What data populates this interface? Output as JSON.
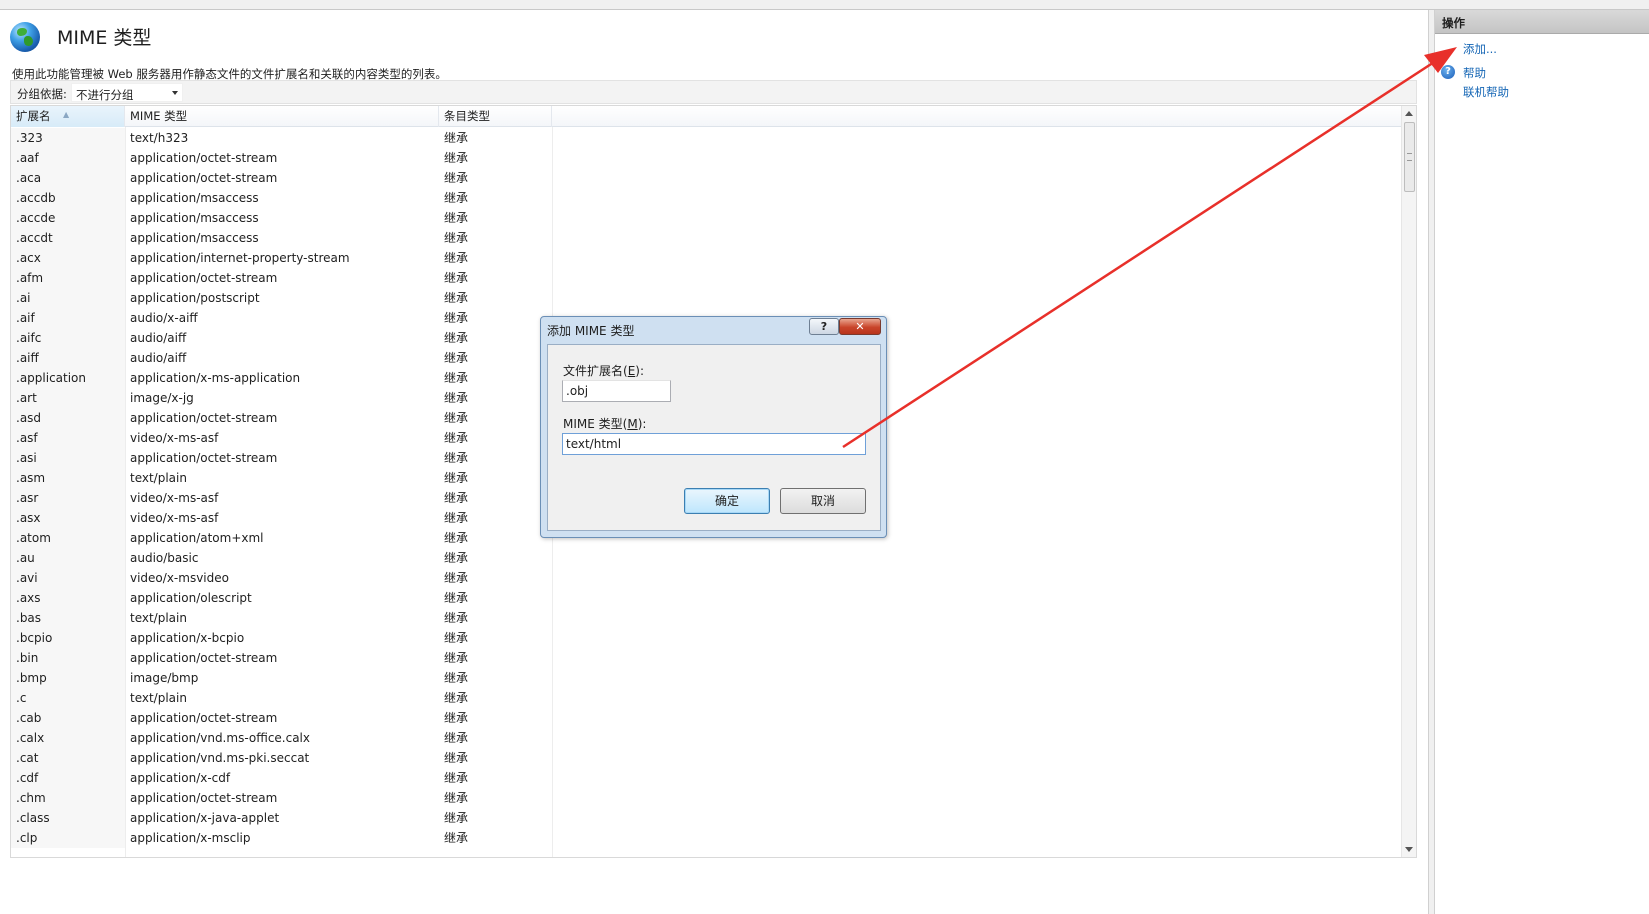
{
  "page": {
    "title": "MIME 类型",
    "description": "使用此功能管理被 Web 服务器用作静态文件的文件扩展名和关联的内容类型的列表。",
    "group_label": "分组依据:",
    "group_value": "不进行分组"
  },
  "table": {
    "columns": [
      "扩展名",
      "MIME 类型",
      "条目类型"
    ],
    "rows": [
      [
        ".323",
        "text/h323",
        "继承"
      ],
      [
        ".aaf",
        "application/octet-stream",
        "继承"
      ],
      [
        ".aca",
        "application/octet-stream",
        "继承"
      ],
      [
        ".accdb",
        "application/msaccess",
        "继承"
      ],
      [
        ".accde",
        "application/msaccess",
        "继承"
      ],
      [
        ".accdt",
        "application/msaccess",
        "继承"
      ],
      [
        ".acx",
        "application/internet-property-stream",
        "继承"
      ],
      [
        ".afm",
        "application/octet-stream",
        "继承"
      ],
      [
        ".ai",
        "application/postscript",
        "继承"
      ],
      [
        ".aif",
        "audio/x-aiff",
        "继承"
      ],
      [
        ".aifc",
        "audio/aiff",
        "继承"
      ],
      [
        ".aiff",
        "audio/aiff",
        "继承"
      ],
      [
        ".application",
        "application/x-ms-application",
        "继承"
      ],
      [
        ".art",
        "image/x-jg",
        "继承"
      ],
      [
        ".asd",
        "application/octet-stream",
        "继承"
      ],
      [
        ".asf",
        "video/x-ms-asf",
        "继承"
      ],
      [
        ".asi",
        "application/octet-stream",
        "继承"
      ],
      [
        ".asm",
        "text/plain",
        "继承"
      ],
      [
        ".asr",
        "video/x-ms-asf",
        "继承"
      ],
      [
        ".asx",
        "video/x-ms-asf",
        "继承"
      ],
      [
        ".atom",
        "application/atom+xml",
        "继承"
      ],
      [
        ".au",
        "audio/basic",
        "继承"
      ],
      [
        ".avi",
        "video/x-msvideo",
        "继承"
      ],
      [
        ".axs",
        "application/olescript",
        "继承"
      ],
      [
        ".bas",
        "text/plain",
        "继承"
      ],
      [
        ".bcpio",
        "application/x-bcpio",
        "继承"
      ],
      [
        ".bin",
        "application/octet-stream",
        "继承"
      ],
      [
        ".bmp",
        "image/bmp",
        "继承"
      ],
      [
        ".c",
        "text/plain",
        "继承"
      ],
      [
        ".cab",
        "application/octet-stream",
        "继承"
      ],
      [
        ".calx",
        "application/vnd.ms-office.calx",
        "继承"
      ],
      [
        ".cat",
        "application/vnd.ms-pki.seccat",
        "继承"
      ],
      [
        ".cdf",
        "application/x-cdf",
        "继承"
      ],
      [
        ".chm",
        "application/octet-stream",
        "继承"
      ],
      [
        ".class",
        "application/x-java-applet",
        "继承"
      ],
      [
        ".clp",
        "application/x-msclip",
        "继承"
      ]
    ]
  },
  "actions": {
    "header": "操作",
    "add": "添加...",
    "help": "帮助",
    "online_help": "联机帮助"
  },
  "dialog": {
    "title": "添加 MIME 类型",
    "help_button": "?",
    "close_button": "✕",
    "ext_label_pre": "文件扩展名(",
    "ext_label_key": "E",
    "ext_label_post": "):",
    "ext_value": ".obj",
    "mime_label_pre": "MIME 类型(",
    "mime_label_key": "M",
    "mime_label_post": "):",
    "mime_value": "text/html",
    "ok": "确定",
    "cancel": "取消"
  },
  "annotation": {
    "arrow_color": "#e8302a"
  }
}
